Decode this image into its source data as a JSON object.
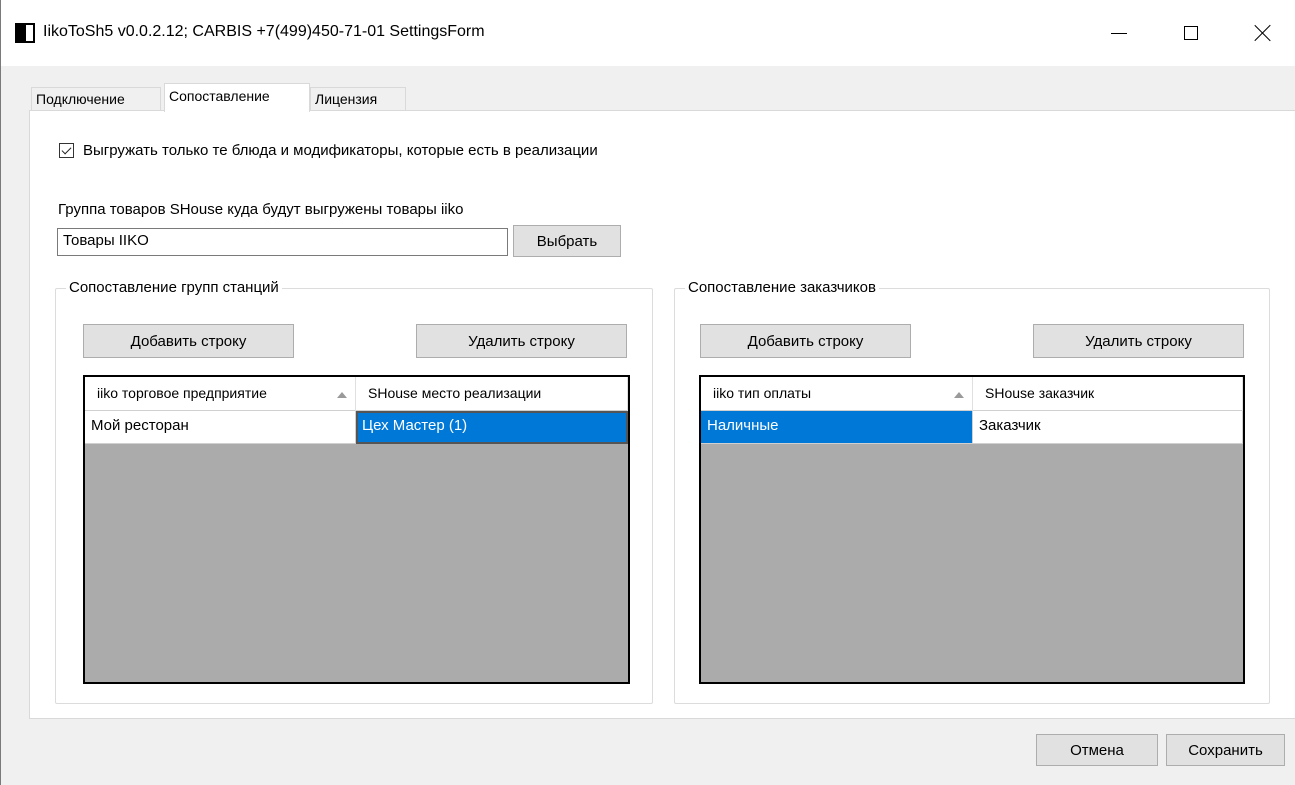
{
  "window": {
    "title": "IikoToSh5 v0.0.2.12;  CARBIS +7(499)450-71-01 SettingsForm"
  },
  "tabs": [
    {
      "label": "Подключение",
      "active": false
    },
    {
      "label": "Сопоставление",
      "active": true
    },
    {
      "label": "Лицензия",
      "active": false
    }
  ],
  "options": {
    "export_only_sold_label": "Выгружать только те блюда и модификаторы, которые есть в реализации",
    "export_only_sold_checked": true
  },
  "product_group": {
    "label": "Группа товаров SHouse куда будут выгружены товары iiko",
    "value": "Товары IIKO",
    "select_button": "Выбрать"
  },
  "station_groups": {
    "title": "Сопоставление групп станций",
    "add_button": "Добавить строку",
    "delete_button": "Удалить строку",
    "columns": [
      "iiko торговое предприятие",
      "SHouse место реализации"
    ],
    "rows": [
      [
        "Мой ресторан",
        "Цех Мастер (1)"
      ]
    ]
  },
  "customers": {
    "title": "Сопоставление заказчиков",
    "add_button": "Добавить строку",
    "delete_button": "Удалить строку",
    "columns": [
      "iiko тип оплаты",
      "SHouse заказчик"
    ],
    "rows": [
      [
        "Наличные",
        "Заказчик"
      ]
    ]
  },
  "footer": {
    "cancel_button": "Отмена",
    "save_button": "Сохранить"
  },
  "colors": {
    "selection": "#0078d7",
    "grid_empty": "#ababab",
    "button": "#e1e1e1"
  }
}
